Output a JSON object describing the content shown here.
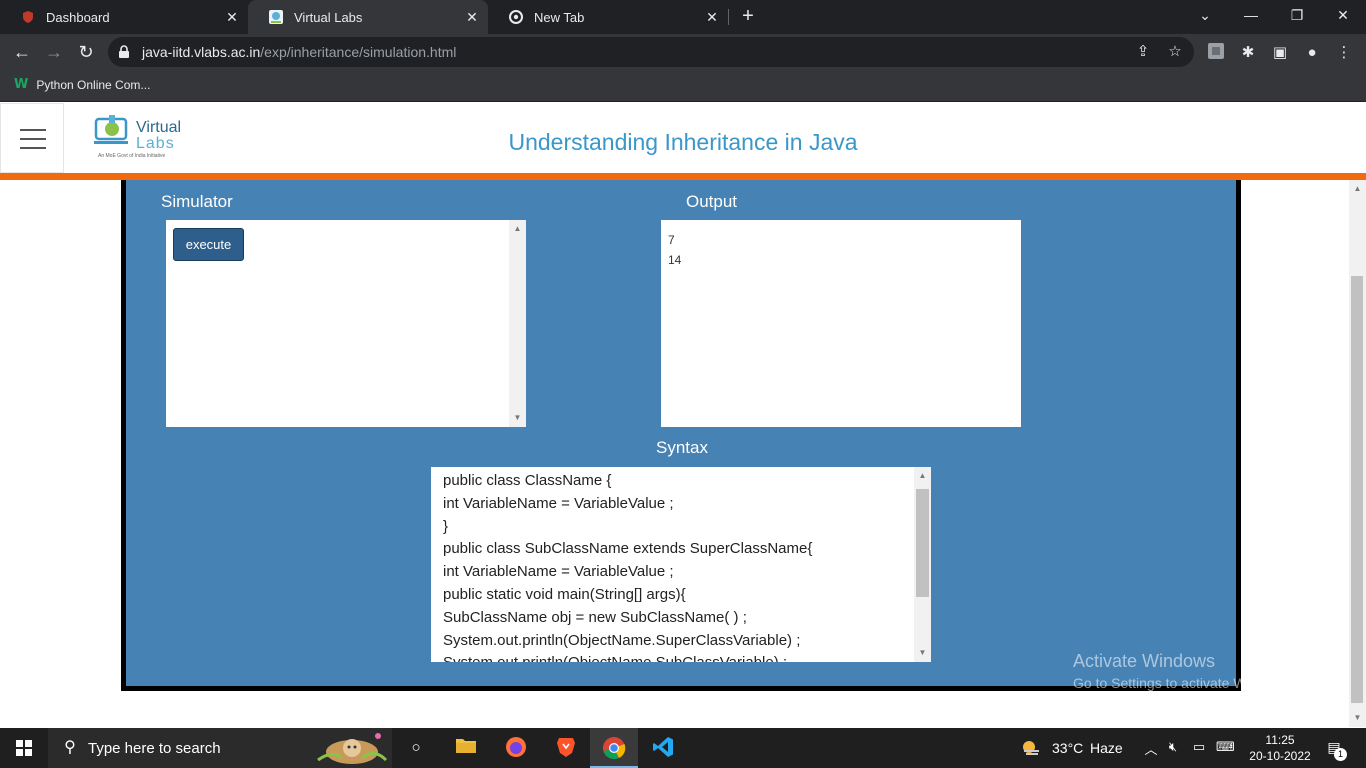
{
  "browser": {
    "tabs": [
      {
        "title": "Dashboard",
        "favicon": "shield-icon"
      },
      {
        "title": "Virtual Labs",
        "favicon": "virtual-labs-icon"
      },
      {
        "title": "New Tab",
        "favicon": "chrome-icon"
      }
    ],
    "active_tab_index": 1,
    "url_host": "java-iitd.vlabs.ac.in",
    "url_path": "/exp/inheritance/simulation.html",
    "bookmarks": [
      {
        "label": "Python Online Com..."
      }
    ]
  },
  "site": {
    "logo_line1": "Virtual",
    "logo_line2": "Labs",
    "logo_tagline": "An MoE Govt of India Initiative",
    "title": "Understanding Inheritance in Java",
    "accent_color": "#f26a0f",
    "panel_color": "#4682b4"
  },
  "simulator": {
    "heading": "Simulator",
    "execute_label": "execute"
  },
  "output": {
    "heading": "Output",
    "lines": [
      "7",
      "14"
    ]
  },
  "syntax": {
    "heading": "Syntax",
    "lines": [
      "public class ClassName {",
      "int VariableName = VariableValue ;",
      "}",
      "public class SubClassName extends SuperClassName{",
      "int VariableName = VariableValue ;",
      "public static void main(String[] args){",
      "SubClassName obj = new SubClassName( ) ;",
      "System.out.println(ObjectName.SuperClassVariable) ;",
      "System.out.println(ObjectName.SubClassVariable) ;"
    ]
  },
  "watermark": {
    "line1": "Activate Windows",
    "line2": "Go to Settings to activate Windows."
  },
  "taskbar": {
    "search_placeholder": "Type here to search",
    "weather_temp": "33°C",
    "weather_desc": "Haze",
    "time": "11:25",
    "date": "20-10-2022",
    "notification_count": "1"
  }
}
